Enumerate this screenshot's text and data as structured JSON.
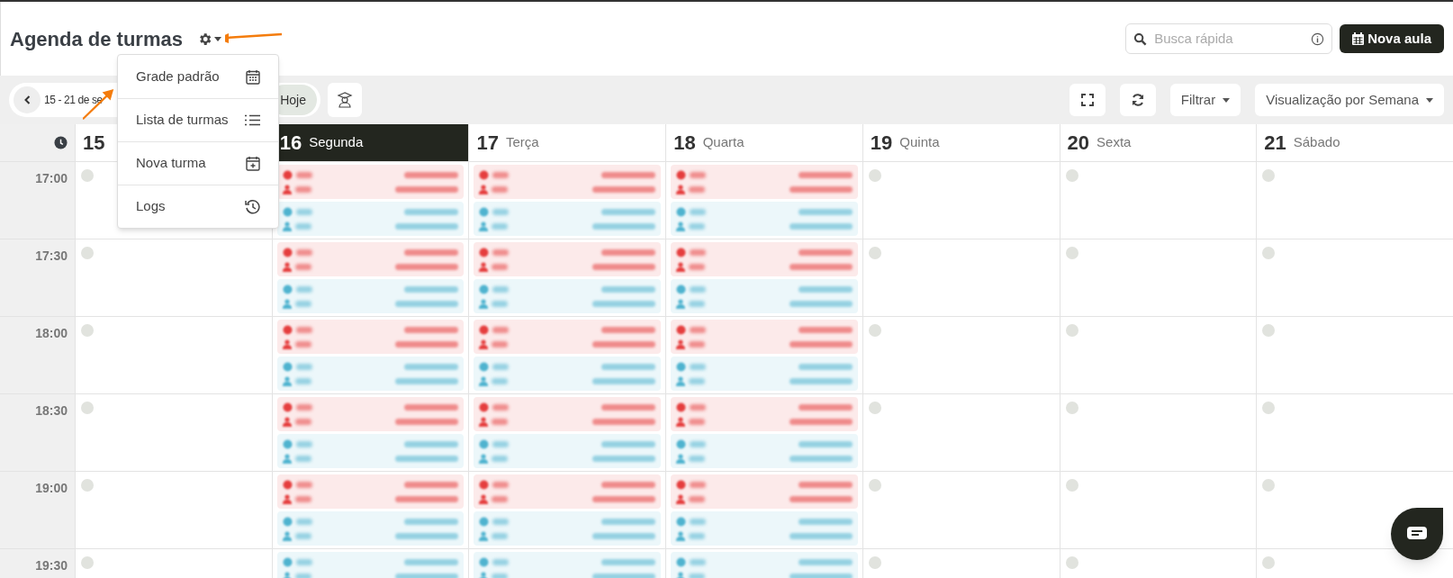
{
  "header": {
    "title": "Agenda de turmas"
  },
  "search": {
    "placeholder": "Busca rápida"
  },
  "new_button": "Nova aula",
  "settings_menu": {
    "items": [
      {
        "label": "Grade padrão"
      },
      {
        "label": "Lista de turmas"
      },
      {
        "label": "Nova turma"
      },
      {
        "label": "Logs"
      }
    ]
  },
  "toolbar": {
    "date_range": "15 - 21 de se",
    "today": "Hoje",
    "filter": "Filtrar",
    "view": "Visualização por Semana"
  },
  "days": [
    {
      "number": "15",
      "selected": false
    },
    {
      "number": "16",
      "weekday": "Segunda",
      "selected": true
    },
    {
      "number": "17",
      "weekday": "Terça",
      "selected": false
    },
    {
      "number": "18",
      "weekday": "Quarta",
      "selected": false
    },
    {
      "number": "19",
      "weekday": "Quinta",
      "selected": false
    },
    {
      "number": "20",
      "weekday": "Sexta",
      "selected": false
    },
    {
      "number": "21",
      "weekday": "Sábado",
      "selected": false
    }
  ],
  "rows": [
    {
      "time": "17:00",
      "cells": [
        {
          "kind": "empty"
        },
        {
          "kind": "events",
          "events": [
            {
              "color": "#e53e3e"
            },
            {
              "color": "#4fb3cf"
            }
          ]
        },
        {
          "kind": "events",
          "events": [
            {
              "color": "#e53e3e"
            },
            {
              "color": "#4fb3cf"
            }
          ]
        },
        {
          "kind": "events",
          "events": [
            {
              "color": "#e53e3e"
            },
            {
              "color": "#4fb3cf"
            }
          ]
        },
        {
          "kind": "empty"
        },
        {
          "kind": "empty"
        },
        {
          "kind": "empty"
        }
      ]
    },
    {
      "time": "17:30",
      "cells": [
        {
          "kind": "empty"
        },
        {
          "kind": "events",
          "events": [
            {
              "color": "#e53e3e"
            },
            {
              "color": "#4fb3cf"
            }
          ]
        },
        {
          "kind": "events",
          "events": [
            {
              "color": "#e53e3e"
            },
            {
              "color": "#4fb3cf"
            }
          ]
        },
        {
          "kind": "events",
          "events": [
            {
              "color": "#e53e3e"
            },
            {
              "color": "#4fb3cf"
            }
          ]
        },
        {
          "kind": "empty"
        },
        {
          "kind": "empty"
        },
        {
          "kind": "empty"
        }
      ]
    },
    {
      "time": "18:00",
      "cells": [
        {
          "kind": "empty"
        },
        {
          "kind": "events",
          "events": [
            {
              "color": "#e53e3e"
            },
            {
              "color": "#4fb3cf"
            }
          ]
        },
        {
          "kind": "events",
          "events": [
            {
              "color": "#e53e3e"
            },
            {
              "color": "#4fb3cf"
            }
          ]
        },
        {
          "kind": "events",
          "events": [
            {
              "color": "#e53e3e"
            },
            {
              "color": "#4fb3cf"
            }
          ]
        },
        {
          "kind": "empty"
        },
        {
          "kind": "empty"
        },
        {
          "kind": "empty"
        }
      ]
    },
    {
      "time": "18:30",
      "cells": [
        {
          "kind": "empty"
        },
        {
          "kind": "events",
          "events": [
            {
              "color": "#e53e3e"
            },
            {
              "color": "#4fb3cf"
            }
          ]
        },
        {
          "kind": "events",
          "events": [
            {
              "color": "#e53e3e"
            },
            {
              "color": "#4fb3cf"
            }
          ]
        },
        {
          "kind": "events",
          "events": [
            {
              "color": "#e53e3e"
            },
            {
              "color": "#4fb3cf"
            }
          ]
        },
        {
          "kind": "empty"
        },
        {
          "kind": "empty"
        },
        {
          "kind": "empty"
        }
      ]
    },
    {
      "time": "19:00",
      "cells": [
        {
          "kind": "empty"
        },
        {
          "kind": "events",
          "events": [
            {
              "color": "#e53e3e"
            },
            {
              "color": "#4fb3cf"
            }
          ]
        },
        {
          "kind": "events",
          "events": [
            {
              "color": "#e53e3e"
            },
            {
              "color": "#4fb3cf"
            }
          ]
        },
        {
          "kind": "events",
          "events": [
            {
              "color": "#e53e3e"
            },
            {
              "color": "#4fb3cf"
            }
          ]
        },
        {
          "kind": "empty"
        },
        {
          "kind": "empty"
        },
        {
          "kind": "empty"
        }
      ]
    },
    {
      "time": "19:30",
      "cells": [
        {
          "kind": "empty"
        },
        {
          "kind": "events",
          "events": [
            {
              "color": "#4fb3cf"
            }
          ]
        },
        {
          "kind": "events",
          "events": [
            {
              "color": "#4fb3cf"
            }
          ]
        },
        {
          "kind": "events",
          "events": [
            {
              "color": "#4fb3cf"
            }
          ]
        },
        {
          "kind": "empty"
        },
        {
          "kind": "empty"
        },
        {
          "kind": "empty"
        }
      ]
    }
  ]
}
